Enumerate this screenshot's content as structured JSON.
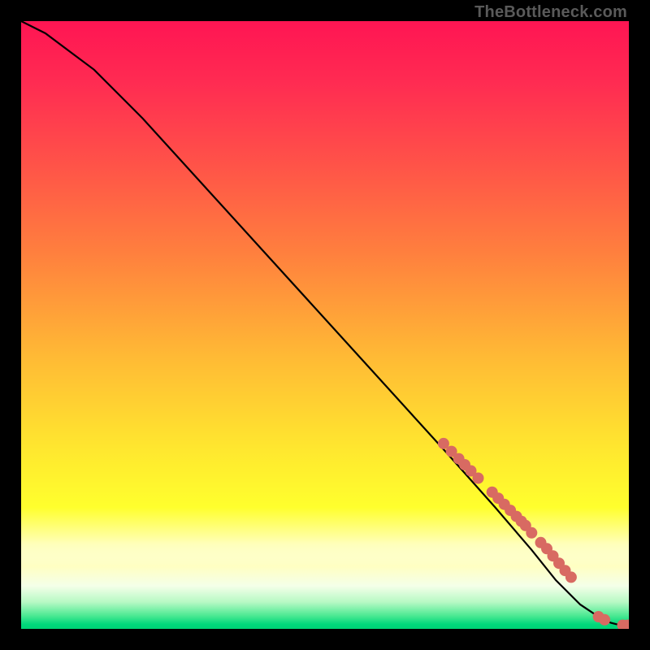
{
  "watermark": "TheBottleneck.com",
  "chart_data": {
    "type": "line",
    "title": "",
    "xlabel": "",
    "ylabel": "",
    "xlim": [
      0,
      100
    ],
    "ylim": [
      0,
      100
    ],
    "curve": {
      "name": "bottleneck-curve",
      "x": [
        0,
        4,
        8,
        12,
        20,
        30,
        40,
        50,
        60,
        70,
        78,
        84,
        88,
        92,
        95,
        97,
        99,
        100
      ],
      "y": [
        100,
        98,
        95,
        92,
        84,
        73,
        62,
        51,
        40,
        29,
        20,
        13,
        8,
        4,
        2,
        1,
        0.5,
        0.5
      ]
    },
    "scatter": {
      "name": "highlighted-points",
      "color": "#d86a62",
      "radius": 7,
      "points": [
        {
          "x": 69.5,
          "y": 30.5
        },
        {
          "x": 70.8,
          "y": 29.2
        },
        {
          "x": 72.0,
          "y": 28.0
        },
        {
          "x": 73.0,
          "y": 27.0
        },
        {
          "x": 74.0,
          "y": 26.0
        },
        {
          "x": 75.2,
          "y": 24.8
        },
        {
          "x": 77.5,
          "y": 22.5
        },
        {
          "x": 78.5,
          "y": 21.5
        },
        {
          "x": 79.5,
          "y": 20.5
        },
        {
          "x": 80.5,
          "y": 19.5
        },
        {
          "x": 81.5,
          "y": 18.5
        },
        {
          "x": 82.3,
          "y": 17.7
        },
        {
          "x": 83.0,
          "y": 17.0
        },
        {
          "x": 84.0,
          "y": 15.8
        },
        {
          "x": 85.5,
          "y": 14.2
        },
        {
          "x": 86.5,
          "y": 13.2
        },
        {
          "x": 87.5,
          "y": 12.0
        },
        {
          "x": 88.5,
          "y": 10.8
        },
        {
          "x": 89.5,
          "y": 9.6
        },
        {
          "x": 90.5,
          "y": 8.5
        },
        {
          "x": 95.0,
          "y": 2.0
        },
        {
          "x": 96.0,
          "y": 1.5
        },
        {
          "x": 99.0,
          "y": 0.6
        },
        {
          "x": 99.8,
          "y": 0.6
        }
      ]
    }
  }
}
